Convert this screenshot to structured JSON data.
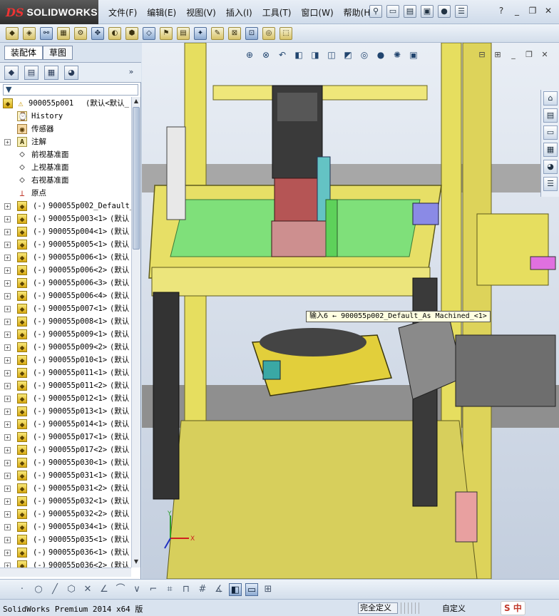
{
  "app": {
    "logo_ds": "DS",
    "logo_name": "SOLIDWORKS"
  },
  "menus": [
    "文件(F)",
    "编辑(E)",
    "视图(V)",
    "插入(I)",
    "工具(T)",
    "窗口(W)",
    "帮助(H)"
  ],
  "title_controls": {
    "help": "?",
    "minimize": "_",
    "restore": "❐",
    "close": "✕"
  },
  "panel": {
    "tabs": [
      "装配体",
      "草图"
    ],
    "expand_arrow": "»",
    "root": {
      "name": "900055p001",
      "config": "(默认<默认_"
    },
    "fixed_items": [
      "History",
      "传感器",
      "注解",
      "前视基准面",
      "上视基准面",
      "右视基准面",
      "原点"
    ],
    "components": [
      {
        "state": "(-)",
        "name": "900055p002_Default_",
        "config": ""
      },
      {
        "state": "(-)",
        "name": "900055p003<1>",
        "config": "(默认"
      },
      {
        "state": "(-)",
        "name": "900055p004<1>",
        "config": "(默认"
      },
      {
        "state": "(-)",
        "name": "900055p005<1>",
        "config": "(默认"
      },
      {
        "state": "(-)",
        "name": "900055p006<1>",
        "config": "(默认"
      },
      {
        "state": "(-)",
        "name": "900055p006<2>",
        "config": "(默认"
      },
      {
        "state": "(-)",
        "name": "900055p006<3>",
        "config": "(默认"
      },
      {
        "state": "(-)",
        "name": "900055p006<4>",
        "config": "(默认"
      },
      {
        "state": "(-)",
        "name": "900055p007<1>",
        "config": "(默认"
      },
      {
        "state": "(-)",
        "name": "900055p008<1>",
        "config": "(默认"
      },
      {
        "state": "(-)",
        "name": "900055p009<1>",
        "config": "(默认"
      },
      {
        "state": "(-)",
        "name": "900055p009<2>",
        "config": "(默认"
      },
      {
        "state": "(-)",
        "name": "900055p010<1>",
        "config": "(默认"
      },
      {
        "state": "(-)",
        "name": "900055p011<1>",
        "config": "(默认"
      },
      {
        "state": "(-)",
        "name": "900055p011<2>",
        "config": "(默认"
      },
      {
        "state": "(-)",
        "name": "900055p012<1>",
        "config": "(默认"
      },
      {
        "state": "(-)",
        "name": "900055p013<1>",
        "config": "(默认"
      },
      {
        "state": "(-)",
        "name": "900055p014<1>",
        "config": "(默认"
      },
      {
        "state": "(-)",
        "name": "900055p017<1>",
        "config": "(默认"
      },
      {
        "state": "(-)",
        "name": "900055p017<2>",
        "config": "(默认"
      },
      {
        "state": "(-)",
        "name": "900055p030<1>",
        "config": "(默认"
      },
      {
        "state": "(-)",
        "name": "900055p031<1>",
        "config": "(默认"
      },
      {
        "state": "(-)",
        "name": "900055p031<2>",
        "config": "(默认"
      },
      {
        "state": "(-)",
        "name": "900055p032<1>",
        "config": "(默认"
      },
      {
        "state": "(-)",
        "name": "900055p032<2>",
        "config": "(默认"
      },
      {
        "state": "(-)",
        "name": "900055p034<1>",
        "config": "(默认"
      },
      {
        "state": "(-)",
        "name": "900055p035<1>",
        "config": "(默认"
      },
      {
        "state": "(-)",
        "name": "900055p036<1>",
        "config": "(默认"
      },
      {
        "state": "(-)",
        "name": "900055p036<2>",
        "config": "(默认"
      }
    ]
  },
  "viewport": {
    "tooltip": "输入6 ← 900055p002_Default_As Machined_<1>",
    "triad_x": "X",
    "triad_y": "Y"
  },
  "status": {
    "product": "SolidWorks Premium 2014 x64 版",
    "definition": "完全定义",
    "units": "自定义",
    "ime": "S 中"
  },
  "colors": {
    "frame_yellow": "#e8e06a",
    "plate_green": "#7fe07a",
    "motor_dark": "#3a3a3a",
    "base_gray": "#9b9b9b",
    "panel_bg": "#d9e3ef"
  }
}
